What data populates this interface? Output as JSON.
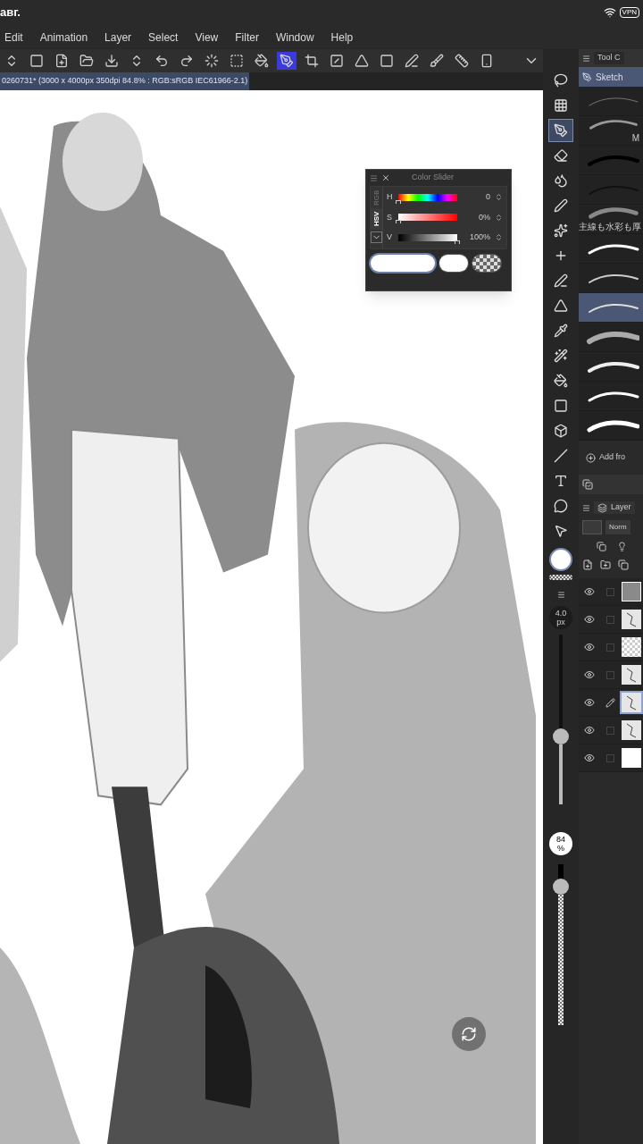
{
  "status_bar": {
    "date": "авг.",
    "vpn": "VPN"
  },
  "menu": [
    "Edit",
    "Animation",
    "Layer",
    "Select",
    "View",
    "Filter",
    "Window",
    "Help"
  ],
  "toolbar": [
    {
      "selected": false
    },
    {
      "selected": false
    },
    {
      "selected": false
    },
    {
      "selected": false
    },
    {
      "selected": false
    },
    {
      "selected": false
    },
    {
      "selected": false
    },
    {
      "selected": false
    },
    {
      "selected": false
    },
    {
      "selected": false
    },
    {
      "selected": false
    },
    {
      "selected": true
    },
    {
      "selected": false
    },
    {
      "selected": false
    },
    {
      "selected": false
    },
    {
      "selected": false
    },
    {
      "selected": false
    },
    {
      "selected": false
    },
    {
      "selected": false
    },
    {
      "selected": false
    }
  ],
  "document_tab": "0260731* (3000 x 4000px 350dpi 84.8% : RGB:sRGB IEC61966-2.1)",
  "color_slider": {
    "title": "Color Slider",
    "modes": [
      {
        "label": "RGB",
        "selected": false
      },
      {
        "label": "HSV",
        "selected": true
      }
    ],
    "rows": [
      {
        "label": "H",
        "kind": "hue",
        "level": 0,
        "reading": "0"
      },
      {
        "label": "S",
        "kind": "saturation",
        "level": 0,
        "reading": "0%"
      },
      {
        "label": "V",
        "kind": "value",
        "level": 1,
        "reading": "100%"
      }
    ],
    "swatches": [
      {
        "kind": "main",
        "selected": true
      },
      {
        "kind": "sub",
        "selected": false
      },
      {
        "kind": "transparent",
        "selected": false
      }
    ]
  },
  "tools": [
    {
      "selected": false
    },
    {
      "selected": false
    },
    {
      "selected": true
    },
    {
      "selected": false
    },
    {
      "selected": false
    },
    {
      "selected": false
    },
    {
      "selected": false
    },
    {
      "selected": false
    },
    {
      "selected": false
    },
    {
      "selected": false
    },
    {
      "selected": false
    },
    {
      "selected": false
    },
    {
      "selected": false
    },
    {
      "selected": false
    },
    {
      "selected": false
    },
    {
      "selected": false
    },
    {
      "selected": false
    },
    {
      "selected": false
    },
    {
      "selected": false
    }
  ],
  "tool_panel": {
    "tab": "Tool C",
    "group": "Sketch",
    "brushes": [
      {
        "selected": false
      },
      {
        "selected": false,
        "label": "M"
      },
      {
        "selected": false
      },
      {
        "selected": false
      },
      {
        "selected": false,
        "label": "主線も水彩も厚"
      },
      {
        "selected": false
      },
      {
        "selected": false
      },
      {
        "selected": true
      },
      {
        "selected": false
      },
      {
        "selected": false
      },
      {
        "selected": false
      },
      {
        "selected": false
      }
    ],
    "add_button": "Add fro"
  },
  "brush_size": {
    "value": "4.0",
    "unit": "px",
    "level": 0.4
  },
  "opacity": {
    "value": "84",
    "unit": "%",
    "level": 0.86
  },
  "layer_panel": {
    "tab": "Layer",
    "blend_mode": "Norm",
    "layers": [
      {
        "visible": true,
        "editing": false,
        "selected": false,
        "kind": "gray"
      },
      {
        "visible": true,
        "editing": false,
        "selected": false,
        "kind": "sketch"
      },
      {
        "visible": true,
        "editing": false,
        "selected": false,
        "kind": "empty"
      },
      {
        "visible": true,
        "editing": false,
        "selected": false,
        "kind": "sketch"
      },
      {
        "visible": true,
        "editing": true,
        "selected": true,
        "kind": "sketch"
      },
      {
        "visible": true,
        "editing": false,
        "selected": false,
        "kind": "sketch"
      },
      {
        "visible": true,
        "editing": false,
        "selected": false,
        "kind": "white"
      }
    ]
  }
}
